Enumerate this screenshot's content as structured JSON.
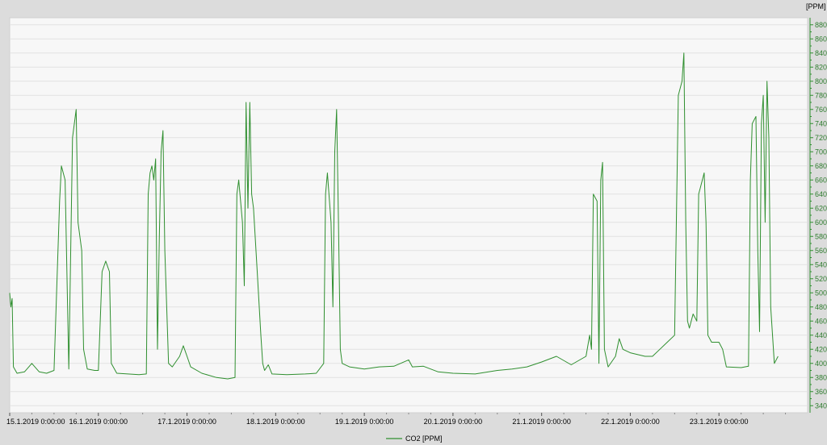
{
  "chart_data": {
    "type": "line",
    "title": "",
    "xlabel": "",
    "ylabel": "[PPM]",
    "ylim": [
      330,
      890
    ],
    "xlim": [
      "15.1.2019 0:00:00",
      "24.1.2019 0:00:00"
    ],
    "y_ticks": [
      340,
      360,
      380,
      400,
      420,
      440,
      460,
      480,
      500,
      520,
      540,
      560,
      580,
      600,
      620,
      640,
      660,
      680,
      700,
      720,
      740,
      760,
      780,
      800,
      820,
      840,
      860,
      880
    ],
    "x_ticks": [
      "15.1.2019 0:00:00",
      "16.1.2019 0:00:00",
      "17.1.2019 0:00:00",
      "18.1.2019 0:00:00",
      "19.1.2019 0:00:00",
      "20.1.2019 0:00:00",
      "21.1.2019 0:00:00",
      "22.1.2019 0:00:00",
      "23.1.2019 0:00:00"
    ],
    "grid": true,
    "legend": {
      "position": "bottom-center",
      "entries": [
        "CO2 [PPM]"
      ]
    },
    "series": [
      {
        "name": "CO2 [PPM]",
        "color": "#2f8f2f",
        "points": [
          [
            "15.1.2019 0:00",
            500
          ],
          [
            "15.1.2019 0:20",
            480
          ],
          [
            "15.1.2019 0:40",
            492
          ],
          [
            "15.1.2019 1:00",
            395
          ],
          [
            "15.1.2019 2:00",
            386
          ],
          [
            "15.1.2019 4:00",
            388
          ],
          [
            "15.1.2019 6:00",
            400
          ],
          [
            "15.1.2019 8:00",
            388
          ],
          [
            "15.1.2019 10:00",
            386
          ],
          [
            "15.1.2019 12:00",
            390
          ],
          [
            "15.1.2019 13:30",
            630
          ],
          [
            "15.1.2019 14:00",
            680
          ],
          [
            "15.1.2019 15:00",
            660
          ],
          [
            "15.1.2019 16:00",
            392
          ],
          [
            "15.1.2019 17:00",
            720
          ],
          [
            "15.1.2019 18:00",
            760
          ],
          [
            "15.1.2019 18:30",
            600
          ],
          [
            "15.1.2019 19:30",
            560
          ],
          [
            "15.1.2019 20:00",
            420
          ],
          [
            "15.1.2019 21:00",
            392
          ],
          [
            "15.1.2019 23:00",
            390
          ],
          [
            "16.1.2019 0:00",
            390
          ],
          [
            "16.1.2019 1:00",
            530
          ],
          [
            "16.1.2019 2:00",
            545
          ],
          [
            "16.1.2019 3:00",
            530
          ],
          [
            "16.1.2019 3:30",
            400
          ],
          [
            "16.1.2019 5:00",
            386
          ],
          [
            "16.1.2019 8:00",
            385
          ],
          [
            "16.1.2019 11:00",
            384
          ],
          [
            "16.1.2019 13:00",
            385
          ],
          [
            "16.1.2019 13:30",
            640
          ],
          [
            "16.1.2019 14:00",
            670
          ],
          [
            "16.1.2019 14:30",
            680
          ],
          [
            "16.1.2019 15:00",
            660
          ],
          [
            "16.1.2019 15:30",
            690
          ],
          [
            "16.1.2019 16:00",
            420
          ],
          [
            "16.1.2019 16:30",
            580
          ],
          [
            "16.1.2019 17:00",
            700
          ],
          [
            "16.1.2019 17:30",
            730
          ],
          [
            "16.1.2019 18:00",
            560
          ],
          [
            "16.1.2019 19:00",
            400
          ],
          [
            "16.1.2019 20:00",
            395
          ],
          [
            "16.1.2019 22:00",
            410
          ],
          [
            "16.1.2019 23:00",
            425
          ],
          [
            "17.1.2019 0:00",
            410
          ],
          [
            "17.1.2019 1:00",
            395
          ],
          [
            "17.1.2019 4:00",
            386
          ],
          [
            "17.1.2019 8:00",
            380
          ],
          [
            "17.1.2019 11:00",
            378
          ],
          [
            "17.1.2019 13:00",
            380
          ],
          [
            "17.1.2019 13:30",
            640
          ],
          [
            "17.1.2019 14:00",
            660
          ],
          [
            "17.1.2019 15:00",
            600
          ],
          [
            "17.1.2019 15:30",
            510
          ],
          [
            "17.1.2019 16:00",
            770
          ],
          [
            "17.1.2019 16:30",
            620
          ],
          [
            "17.1.2019 17:00",
            770
          ],
          [
            "17.1.2019 17:30",
            640
          ],
          [
            "17.1.2019 18:00",
            620
          ],
          [
            "17.1.2019 19:00",
            530
          ],
          [
            "17.1.2019 20:00",
            440
          ],
          [
            "17.1.2019 20:30",
            400
          ],
          [
            "17.1.2019 21:00",
            390
          ],
          [
            "17.1.2019 22:00",
            398
          ],
          [
            "17.1.2019 23:00",
            385
          ],
          [
            "18.1.2019 3:00",
            384
          ],
          [
            "18.1.2019 8:00",
            385
          ],
          [
            "18.1.2019 11:00",
            386
          ],
          [
            "18.1.2019 13:00",
            400
          ],
          [
            "18.1.2019 13:30",
            640
          ],
          [
            "18.1.2019 14:00",
            670
          ],
          [
            "18.1.2019 15:00",
            600
          ],
          [
            "18.1.2019 15:30",
            480
          ],
          [
            "18.1.2019 16:00",
            700
          ],
          [
            "18.1.2019 16:30",
            760
          ],
          [
            "18.1.2019 17:00",
            600
          ],
          [
            "18.1.2019 17:30",
            420
          ],
          [
            "18.1.2019 18:00",
            400
          ],
          [
            "18.1.2019 20:00",
            395
          ],
          [
            "19.1.2019 0:00",
            392
          ],
          [
            "19.1.2019 4:00",
            395
          ],
          [
            "19.1.2019 8:00",
            396
          ],
          [
            "19.1.2019 12:00",
            405
          ],
          [
            "19.1.2019 13:00",
            395
          ],
          [
            "19.1.2019 16:00",
            396
          ],
          [
            "19.1.2019 20:00",
            388
          ],
          [
            "20.1.2019 0:00",
            386
          ],
          [
            "20.1.2019 6:00",
            385
          ],
          [
            "20.1.2019 12:00",
            390
          ],
          [
            "20.1.2019 16:00",
            392
          ],
          [
            "20.1.2019 20:00",
            395
          ],
          [
            "21.1.2019 0:00",
            402
          ],
          [
            "21.1.2019 4:00",
            410
          ],
          [
            "21.1.2019 8:00",
            398
          ],
          [
            "21.1.2019 12:00",
            410
          ],
          [
            "21.1.2019 13:00",
            440
          ],
          [
            "21.1.2019 13:30",
            420
          ],
          [
            "21.1.2019 14:00",
            640
          ],
          [
            "21.1.2019 15:00",
            630
          ],
          [
            "21.1.2019 15:30",
            400
          ],
          [
            "21.1.2019 16:00",
            660
          ],
          [
            "21.1.2019 16:30",
            685
          ],
          [
            "21.1.2019 17:00",
            420
          ],
          [
            "21.1.2019 18:00",
            395
          ],
          [
            "21.1.2019 20:00",
            410
          ],
          [
            "21.1.2019 21:00",
            435
          ],
          [
            "21.1.2019 22:00",
            420
          ],
          [
            "22.1.2019 0:00",
            415
          ],
          [
            "22.1.2019 4:00",
            410
          ],
          [
            "22.1.2019 6:00",
            410
          ],
          [
            "22.1.2019 8:00",
            420
          ],
          [
            "22.1.2019 10:00",
            430
          ],
          [
            "22.1.2019 12:00",
            440
          ],
          [
            "22.1.2019 13:00",
            780
          ],
          [
            "22.1.2019 14:00",
            800
          ],
          [
            "22.1.2019 14:30",
            840
          ],
          [
            "22.1.2019 15:00",
            600
          ],
          [
            "22.1.2019 15:30",
            460
          ],
          [
            "22.1.2019 16:00",
            450
          ],
          [
            "22.1.2019 17:00",
            470
          ],
          [
            "22.1.2019 18:00",
            460
          ],
          [
            "22.1.2019 18:30",
            640
          ],
          [
            "22.1.2019 19:00",
            650
          ],
          [
            "22.1.2019 20:00",
            670
          ],
          [
            "22.1.2019 20:30",
            600
          ],
          [
            "22.1.2019 21:00",
            440
          ],
          [
            "22.1.2019 22:00",
            430
          ],
          [
            "23.1.2019 0:00",
            430
          ],
          [
            "23.1.2019 1:00",
            420
          ],
          [
            "23.1.2019 2:00",
            395
          ],
          [
            "23.1.2019 6:00",
            394
          ],
          [
            "23.1.2019 8:00",
            396
          ],
          [
            "23.1.2019 8:30",
            660
          ],
          [
            "23.1.2019 9:00",
            740
          ],
          [
            "23.1.2019 10:00",
            750
          ],
          [
            "23.1.2019 10:30",
            560
          ],
          [
            "23.1.2019 11:00",
            445
          ],
          [
            "23.1.2019 11:30",
            740
          ],
          [
            "23.1.2019 12:00",
            780
          ],
          [
            "23.1.2019 12:30",
            600
          ],
          [
            "23.1.2019 13:00",
            800
          ],
          [
            "23.1.2019 13:30",
            720
          ],
          [
            "23.1.2019 14:00",
            480
          ],
          [
            "23.1.2019 15:00",
            400
          ],
          [
            "23.1.2019 16:00",
            410
          ]
        ]
      }
    ]
  }
}
